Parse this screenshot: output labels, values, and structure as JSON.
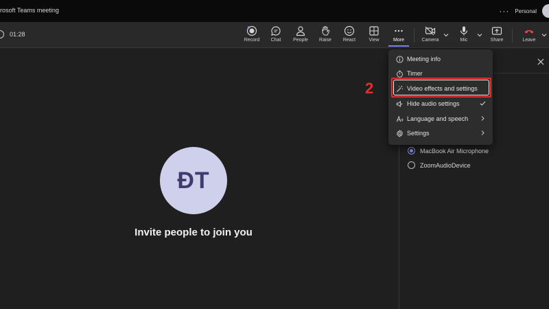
{
  "window": {
    "title": "rosoft Teams meeting",
    "more": "···",
    "profile": "Personal"
  },
  "toolbar": {
    "timer": "01:28",
    "buttons": {
      "record": "Record",
      "chat": "Chat",
      "people": "People",
      "raise": "Raise",
      "react": "React",
      "view": "View",
      "more": "More",
      "camera": "Camera",
      "mic": "Mic",
      "share": "Share",
      "leave": "Leave"
    }
  },
  "stage": {
    "initials": "ĐT",
    "invite": "Invite people to join you"
  },
  "more_menu": {
    "items": [
      {
        "label": "Meeting info",
        "icon": "info-icon"
      },
      {
        "label": "Timer",
        "icon": "stopwatch-icon"
      },
      {
        "label": "Video effects and settings",
        "icon": "magic-wand-icon"
      },
      {
        "label": "Hide audio settings",
        "icon": "speaker-icon",
        "right": "check-icon"
      },
      {
        "label": "Language and speech",
        "icon": "language-icon",
        "right": "chevron-right-icon"
      },
      {
        "label": "Settings",
        "icon": "gear-icon",
        "right": "chevron-right-icon"
      }
    ]
  },
  "annotation": {
    "step": "2",
    "color": "#e03030"
  },
  "side_panel": {
    "mics": [
      {
        "label": "MacBook Air Microphone",
        "selected": true
      },
      {
        "label": "ZoomAudioDevice",
        "selected": false
      }
    ]
  },
  "colors": {
    "accent": "#7f85f5",
    "leave": "#e0474c",
    "avatar_bg": "#cfd0ec"
  }
}
